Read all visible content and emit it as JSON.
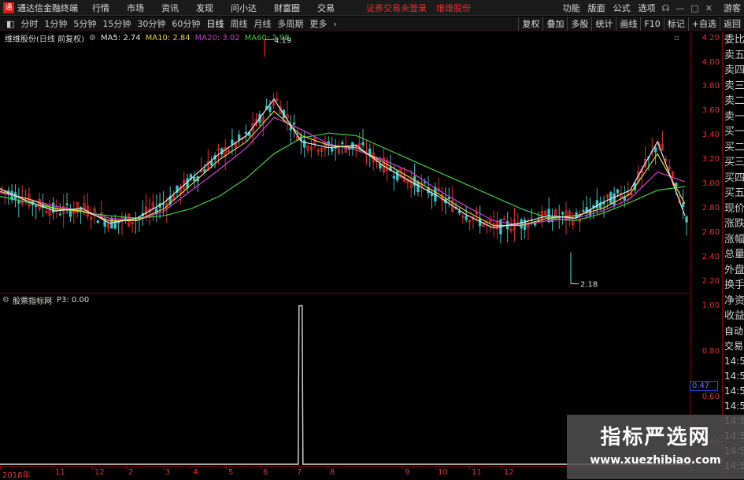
{
  "app": {
    "title": "通达信金融终端",
    "logo_text": "通"
  },
  "menubar": {
    "items": [
      "行情",
      "市场",
      "资讯",
      "发现",
      "问小达",
      "财富圈",
      "交易"
    ],
    "notice": "证券交易未登录",
    "stock_name": "维维股份",
    "right_items": [
      "功能",
      "版面",
      "公式",
      "选项"
    ],
    "guest": "游客"
  },
  "toolbar": {
    "periods": [
      "分时",
      "1分钟",
      "5分钟",
      "15分钟",
      "30分钟",
      "60分钟",
      "日线",
      "周线",
      "月线",
      "多周期",
      "更多"
    ],
    "active_period": "日线",
    "buttons": [
      "复权",
      "叠加",
      "多股",
      "统计",
      "画线",
      "F10",
      "标记",
      "+自选",
      "返回"
    ]
  },
  "main_info": {
    "stock": "维维股份(日线 前复权)",
    "ma5": "MA5: 2.74",
    "ma10": "MA10: 2.84",
    "ma20": "MA20: 3.02",
    "ma60": "MA60: 2.98",
    "ma5_color": "#e8e8e8",
    "ma10_color": "#e8d040",
    "ma20_color": "#d040d0",
    "ma60_color": "#40d040"
  },
  "price_scale": [
    "4.20",
    "4.00",
    "3.80",
    "3.60",
    "3.40",
    "3.20",
    "3.00",
    "2.80",
    "2.60",
    "2.40",
    "2.20"
  ],
  "high_label": "4.19",
  "low_label": "2.18",
  "sub_info": {
    "name": "股票指标网",
    "value": "P3: 0.00"
  },
  "sub_scale": [
    "1.00",
    "0.80",
    "0.60",
    "0.40"
  ],
  "current_value": "0.47",
  "right_panel": [
    "委比",
    "卖五",
    "卖四",
    "卖三",
    "卖二",
    "卖一",
    "买一",
    "买二",
    "买三",
    "买四",
    "买五",
    "现价",
    "涨跌",
    "涨幅",
    "总量",
    "外盘",
    "换手",
    "净资",
    "收益"
  ],
  "right_panel_lower": [
    "自动",
    "交易",
    "14:56",
    "14:56",
    "14:56",
    "14:56",
    "14:56",
    "14:56",
    "14:56",
    "14:56"
  ],
  "x_axis": [
    "2018年",
    "11",
    "12",
    "2",
    "3",
    "4",
    "5",
    "6",
    "7",
    "8",
    "9",
    "10",
    "11",
    "12"
  ],
  "watermark": {
    "line1": "指标严选网",
    "line2": "www.xuezhibiao.com"
  },
  "colors": {
    "up": "#e03030",
    "down": "#40c0c0",
    "border": "#8b0000",
    "accent": "#e03030"
  },
  "chart_data": {
    "type": "line",
    "title": "维维股份(日线 前复权)",
    "ylim": [
      2.1,
      4.25
    ],
    "series": [
      {
        "name": "MA60",
        "values": [
          2.9,
          2.85,
          2.8,
          2.77,
          2.74,
          2.72,
          2.74,
          2.8,
          2.9,
          3.05,
          3.25,
          3.38,
          3.42,
          3.4,
          3.3,
          3.2,
          3.1,
          3.0,
          2.9,
          2.8,
          2.72,
          2.7,
          2.76,
          2.85,
          2.95,
          2.98
        ]
      },
      {
        "name": "MA20",
        "values": [
          2.93,
          2.88,
          2.82,
          2.78,
          2.72,
          2.7,
          2.78,
          2.95,
          3.12,
          3.3,
          3.55,
          3.45,
          3.33,
          3.28,
          3.2,
          3.1,
          2.95,
          2.82,
          2.7,
          2.66,
          2.7,
          2.72,
          2.78,
          2.88,
          3.1,
          3.02
        ]
      },
      {
        "name": "MA10",
        "values": [
          2.94,
          2.88,
          2.8,
          2.78,
          2.7,
          2.7,
          2.8,
          3.0,
          3.2,
          3.35,
          3.6,
          3.4,
          3.32,
          3.3,
          3.18,
          3.05,
          2.92,
          2.78,
          2.66,
          2.66,
          2.72,
          2.74,
          2.8,
          2.92,
          3.25,
          2.84
        ]
      },
      {
        "name": "MA5",
        "values": [
          2.96,
          2.86,
          2.78,
          2.8,
          2.68,
          2.72,
          2.85,
          3.05,
          3.25,
          3.4,
          3.7,
          3.35,
          3.3,
          3.32,
          3.15,
          3.02,
          2.9,
          2.75,
          2.64,
          2.68,
          2.74,
          2.72,
          2.85,
          2.95,
          3.35,
          2.74
        ]
      }
    ],
    "indicator": {
      "name": "股票指标网 P3",
      "ylim": [
        0.3,
        1.05
      ],
      "spike_value": 1.0,
      "spike_index": 11,
      "total": 26
    }
  }
}
